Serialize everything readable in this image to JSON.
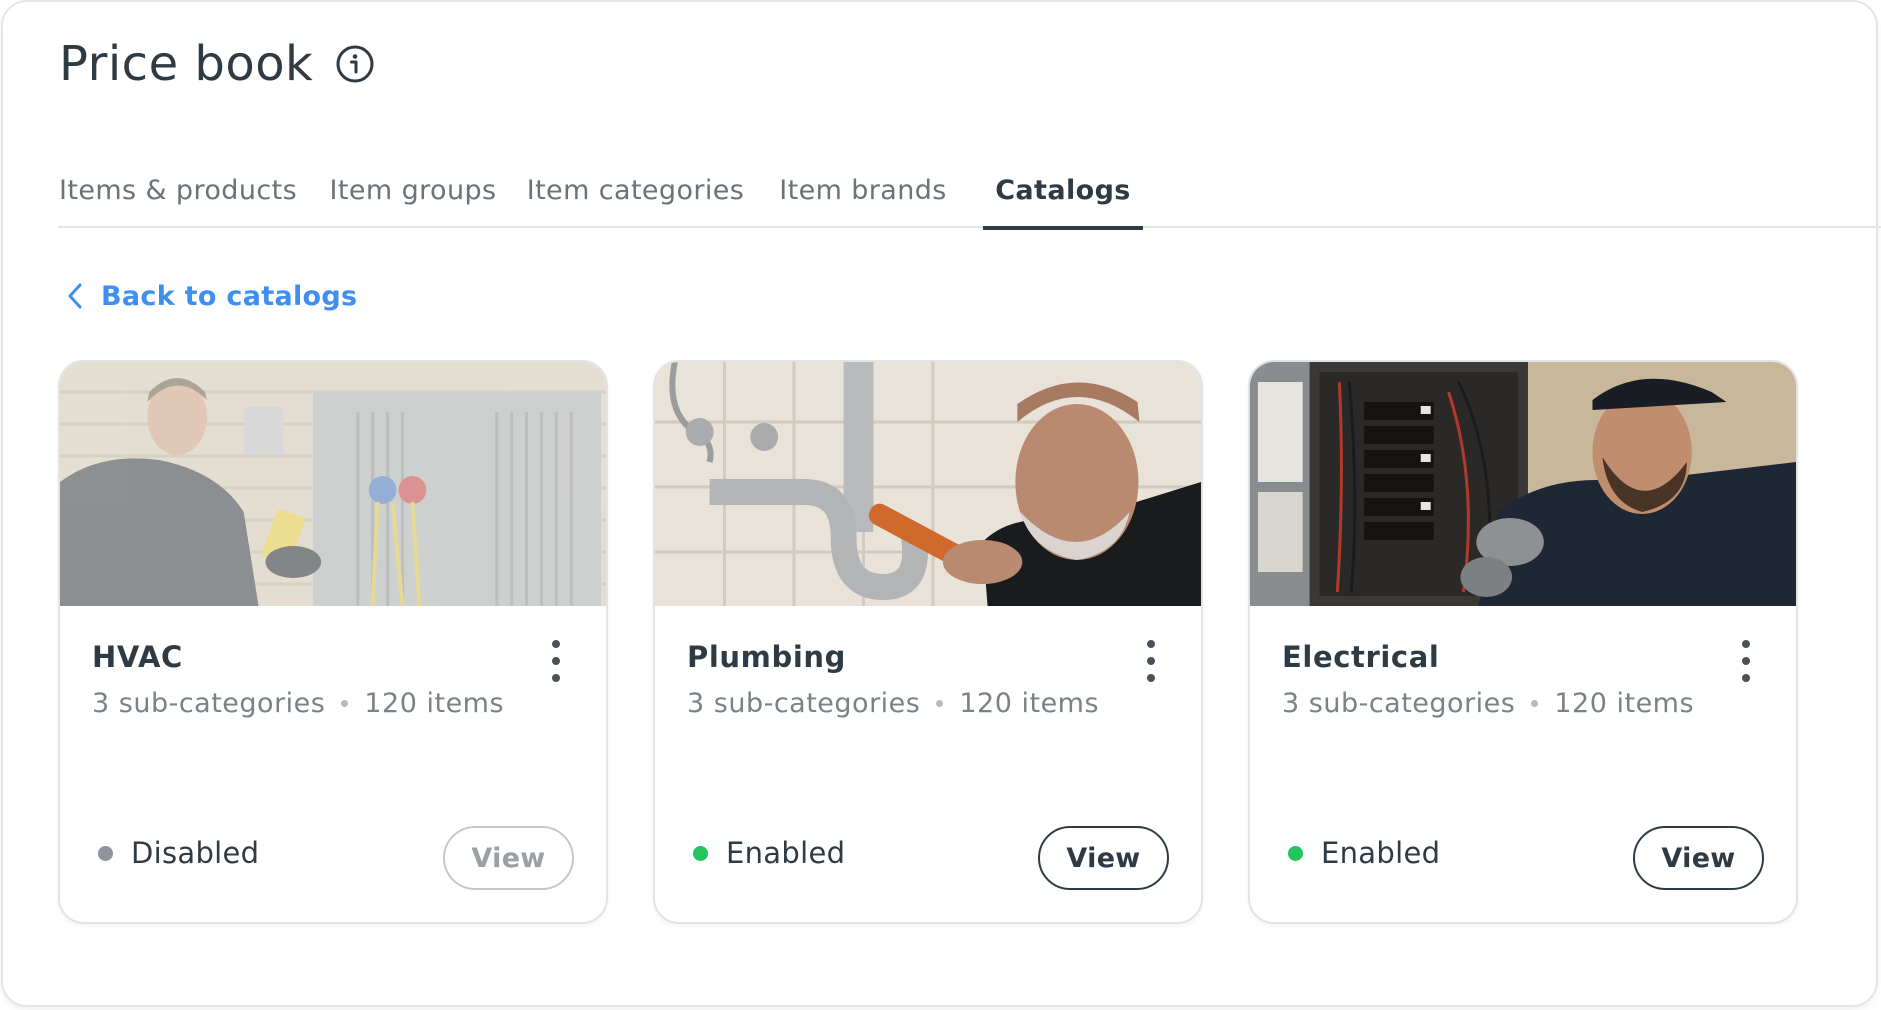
{
  "page": {
    "title": "Price book",
    "info_icon": "info-icon"
  },
  "tabs": [
    {
      "label": "Items & products",
      "active": false
    },
    {
      "label": "Item groups",
      "active": false
    },
    {
      "label": "Item categories",
      "active": false
    },
    {
      "label": "Item brands",
      "active": false
    },
    {
      "label": "Catalogs",
      "active": true
    }
  ],
  "back_link": {
    "label": "Back to catalogs",
    "icon": "chevron-left-icon",
    "color": "#3f8ff0"
  },
  "cards": [
    {
      "title": "HVAC",
      "subcategories": "3 sub-categories",
      "items": "120 items",
      "status": "Disabled",
      "status_color": "#8e9499",
      "button": "View",
      "image": "hvac-technician-photo"
    },
    {
      "title": "Plumbing",
      "subcategories": "3 sub-categories",
      "items": "120 items",
      "status": "Enabled",
      "status_color": "#22c55e",
      "button": "View",
      "image": "plumber-photo"
    },
    {
      "title": "Electrical",
      "subcategories": "3 sub-categories",
      "items": "120 items",
      "status": "Enabled",
      "status_color": "#22c55e",
      "button": "View",
      "image": "electrician-photo"
    }
  ],
  "colors": {
    "text_primary": "#2f3b44",
    "text_muted": "#6b737a",
    "border": "#e1e3e5"
  }
}
